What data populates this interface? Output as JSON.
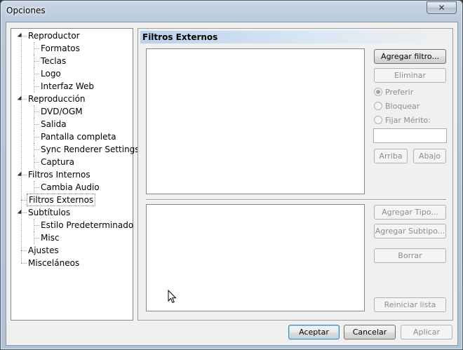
{
  "window": {
    "title": "Opciones",
    "close_glyph": "✕"
  },
  "tree": [
    {
      "label": "Reproductor",
      "level": 0,
      "expandable": true
    },
    {
      "label": "Formatos",
      "level": 1
    },
    {
      "label": "Teclas",
      "level": 1
    },
    {
      "label": "Logo",
      "level": 1
    },
    {
      "label": "Interfaz Web",
      "level": 1
    },
    {
      "label": "Reproducción",
      "level": 0,
      "expandable": true
    },
    {
      "label": "DVD/OGM",
      "level": 1
    },
    {
      "label": "Salida",
      "level": 1
    },
    {
      "label": "Pantalla completa",
      "level": 1
    },
    {
      "label": "Sync Renderer Settings",
      "level": 1
    },
    {
      "label": "Captura",
      "level": 1
    },
    {
      "label": "Filtros Internos",
      "level": 0,
      "expandable": true
    },
    {
      "label": "Cambia Audio",
      "level": 1
    },
    {
      "label": "Filtros Externos",
      "level": 0,
      "selected": true
    },
    {
      "label": "Subtítulos",
      "level": 0,
      "expandable": true
    },
    {
      "label": "Estilo Predeterminado",
      "level": 1
    },
    {
      "label": "Misc",
      "level": 1
    },
    {
      "label": "Ajustes",
      "level": 0
    },
    {
      "label": "Misceláneos",
      "level": 0
    }
  ],
  "panel": {
    "title": "Filtros Externos",
    "add_filter": "Agregar filtro...",
    "remove": "Eliminar",
    "prefer": "Preferir",
    "block": "Bloquear",
    "set_merit": "Fijar Mérito:",
    "merit_value": "",
    "up": "Arriba",
    "down": "Abajo",
    "add_type": "Agregar Tipo...",
    "add_subtype": "Agregar Subtipo...",
    "delete": "Borrar",
    "reset_list": "Reiniciar lista"
  },
  "footer": {
    "accept": "Aceptar",
    "cancel": "Cancelar",
    "apply": "Aplicar"
  },
  "colors": {
    "header_gradient_start": "#b9d1ea",
    "disabled_text": "#8d8d8d"
  }
}
